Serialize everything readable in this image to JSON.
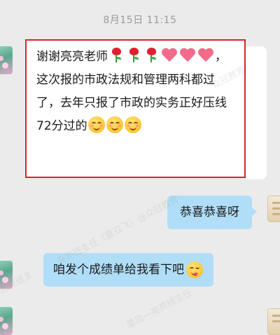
{
  "timestamp": "8月15日  11:15",
  "message_received": {
    "text_1": "谢谢亮亮老师",
    "text_2": "，这次报的市政法规和管理两科都过了，去年只报了市政的实务正好压线72分过的",
    "emoji_roses": [
      "rose",
      "rose",
      "rose"
    ],
    "emoji_hearts": [
      "heart",
      "heart",
      "heart"
    ],
    "emoji_smiles": [
      "smiling-face",
      "smiling-face",
      "smiling-face"
    ]
  },
  "message_sent": {
    "text": "恭喜恭喜呀"
  },
  "message_followup": {
    "text": "咱发个成绩单给我看下吧",
    "emoji": "winking-face"
  },
  "watermarks": [
    "亮亮班主任（嘉双飞）@众冠教育",
    "众冠教育",
    "菜瓜一亮亮班主任",
    "亮亮班主"
  ],
  "colors": {
    "highlight_border": "#d8232a",
    "bubble_blue": "#b0def8",
    "background": "#ebebeb"
  }
}
